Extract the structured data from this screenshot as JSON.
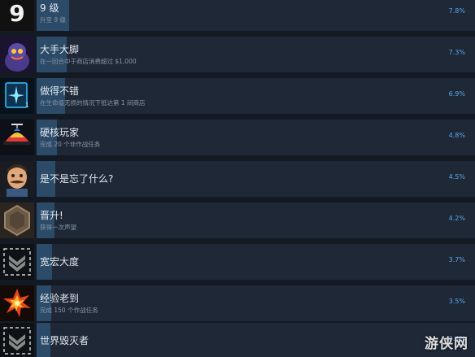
{
  "achievements": [
    {
      "icon": "number-nine-icon",
      "name": "9 级",
      "desc": "升至 9 级",
      "percent_label": "7.8%",
      "percent": 7.8
    },
    {
      "icon": "bigfoot-creature-icon",
      "name": "大手大脚",
      "desc": "在一回合中于商店消费超过 $1,000",
      "percent_label": "7.3%",
      "percent": 7.3
    },
    {
      "icon": "glowing-card-icon",
      "name": "做得不错",
      "desc": "在生命值无损的情况下抵达第 1 间商店",
      "percent_label": "6.9%",
      "percent": 6.9,
      "icon_badge": "1"
    },
    {
      "icon": "propeller-cap-icon",
      "name": "硬核玩家",
      "desc": "完成 20 个非作战任务",
      "percent_label": "4.8%",
      "percent": 4.8
    },
    {
      "icon": "mustache-man-icon",
      "name": "是不是忘了什么?",
      "desc": "",
      "percent_label": "4.5%",
      "percent": 4.5
    },
    {
      "icon": "hexagon-badge-icon",
      "name": "晋升!",
      "desc": "获得一次声望",
      "percent_label": "4.2%",
      "percent": 4.2
    },
    {
      "icon": "chevron-rank-icon",
      "name": "宽宏大度",
      "desc": "",
      "percent_label": "3.7%",
      "percent": 3.7
    },
    {
      "icon": "explosion-icon",
      "name": "经验老到",
      "desc": "完成 150 个作战任务",
      "percent_label": "3.5%",
      "percent": 3.5
    },
    {
      "icon": "chevron-rank-icon",
      "name": "世界毁灭者",
      "desc": "",
      "percent_label": "3.4%",
      "percent": 3.4
    }
  ],
  "watermark": "游侠网"
}
